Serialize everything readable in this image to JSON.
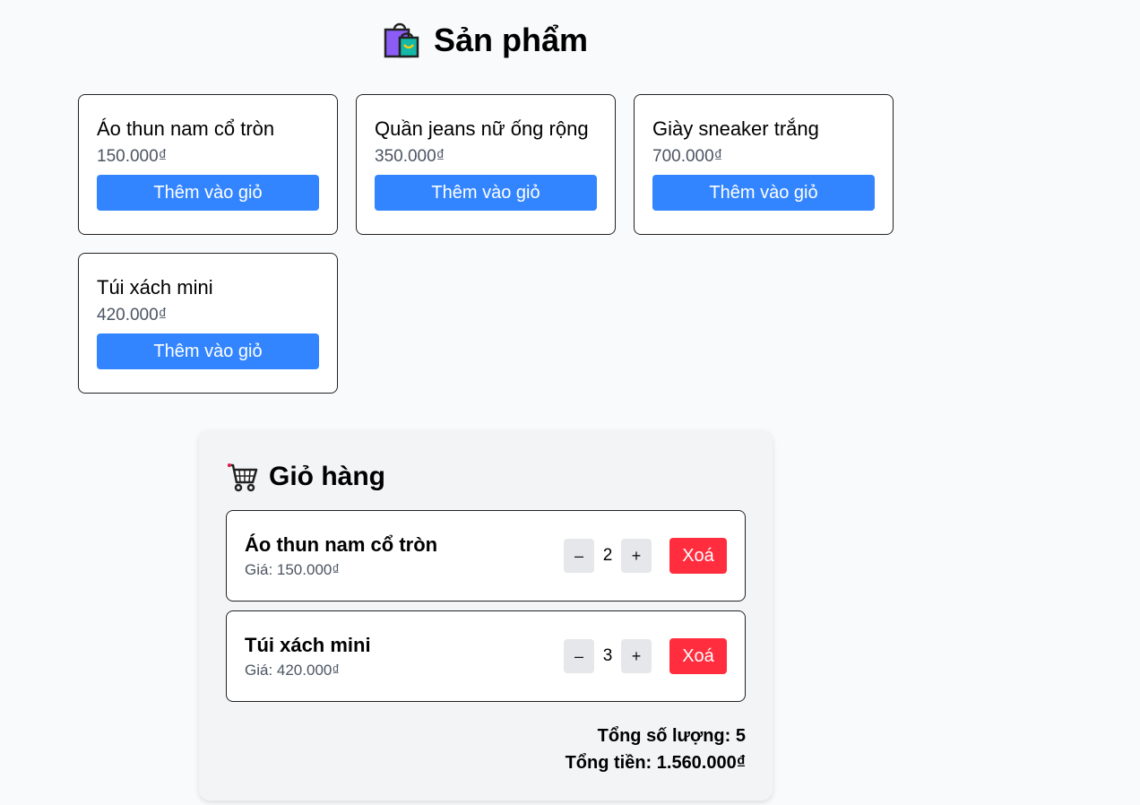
{
  "products_section": {
    "icon": "shopping-bags-icon",
    "title": "Sản phẩm"
  },
  "products": [
    {
      "name": "Áo thun nam cổ tròn",
      "price": "150.000₫",
      "button": "Thêm vào giỏ"
    },
    {
      "name": "Quần jeans nữ ống rộng",
      "price": "350.000₫",
      "button": "Thêm vào giỏ"
    },
    {
      "name": "Giày sneaker trắng",
      "price": "700.000₫",
      "button": "Thêm vào giỏ"
    },
    {
      "name": "Túi xách mini",
      "price": "420.000₫",
      "button": "Thêm vào giỏ"
    }
  ],
  "cart": {
    "icon": "shopping-cart-icon",
    "title": "Giỏ hàng",
    "items": [
      {
        "name": "Áo thun nam cổ tròn",
        "price": "Giá: 150.000₫",
        "decrement": "–",
        "quantity": "2",
        "increment": "+",
        "remove": "Xoá"
      },
      {
        "name": "Túi xách mini",
        "price": "Giá: 420.000₫",
        "decrement": "–",
        "quantity": "3",
        "increment": "+",
        "remove": "Xoá"
      }
    ],
    "total_quantity": "Tổng số lượng: 5",
    "total_price": "Tổng tiền: 1.560.000₫"
  },
  "colors": {
    "primary_button": "#3385ff",
    "danger_button": "#ff2d3d",
    "qty_button": "#e5e7eb",
    "cart_background": "#f3f4f6",
    "page_background": "#f9fafb"
  }
}
